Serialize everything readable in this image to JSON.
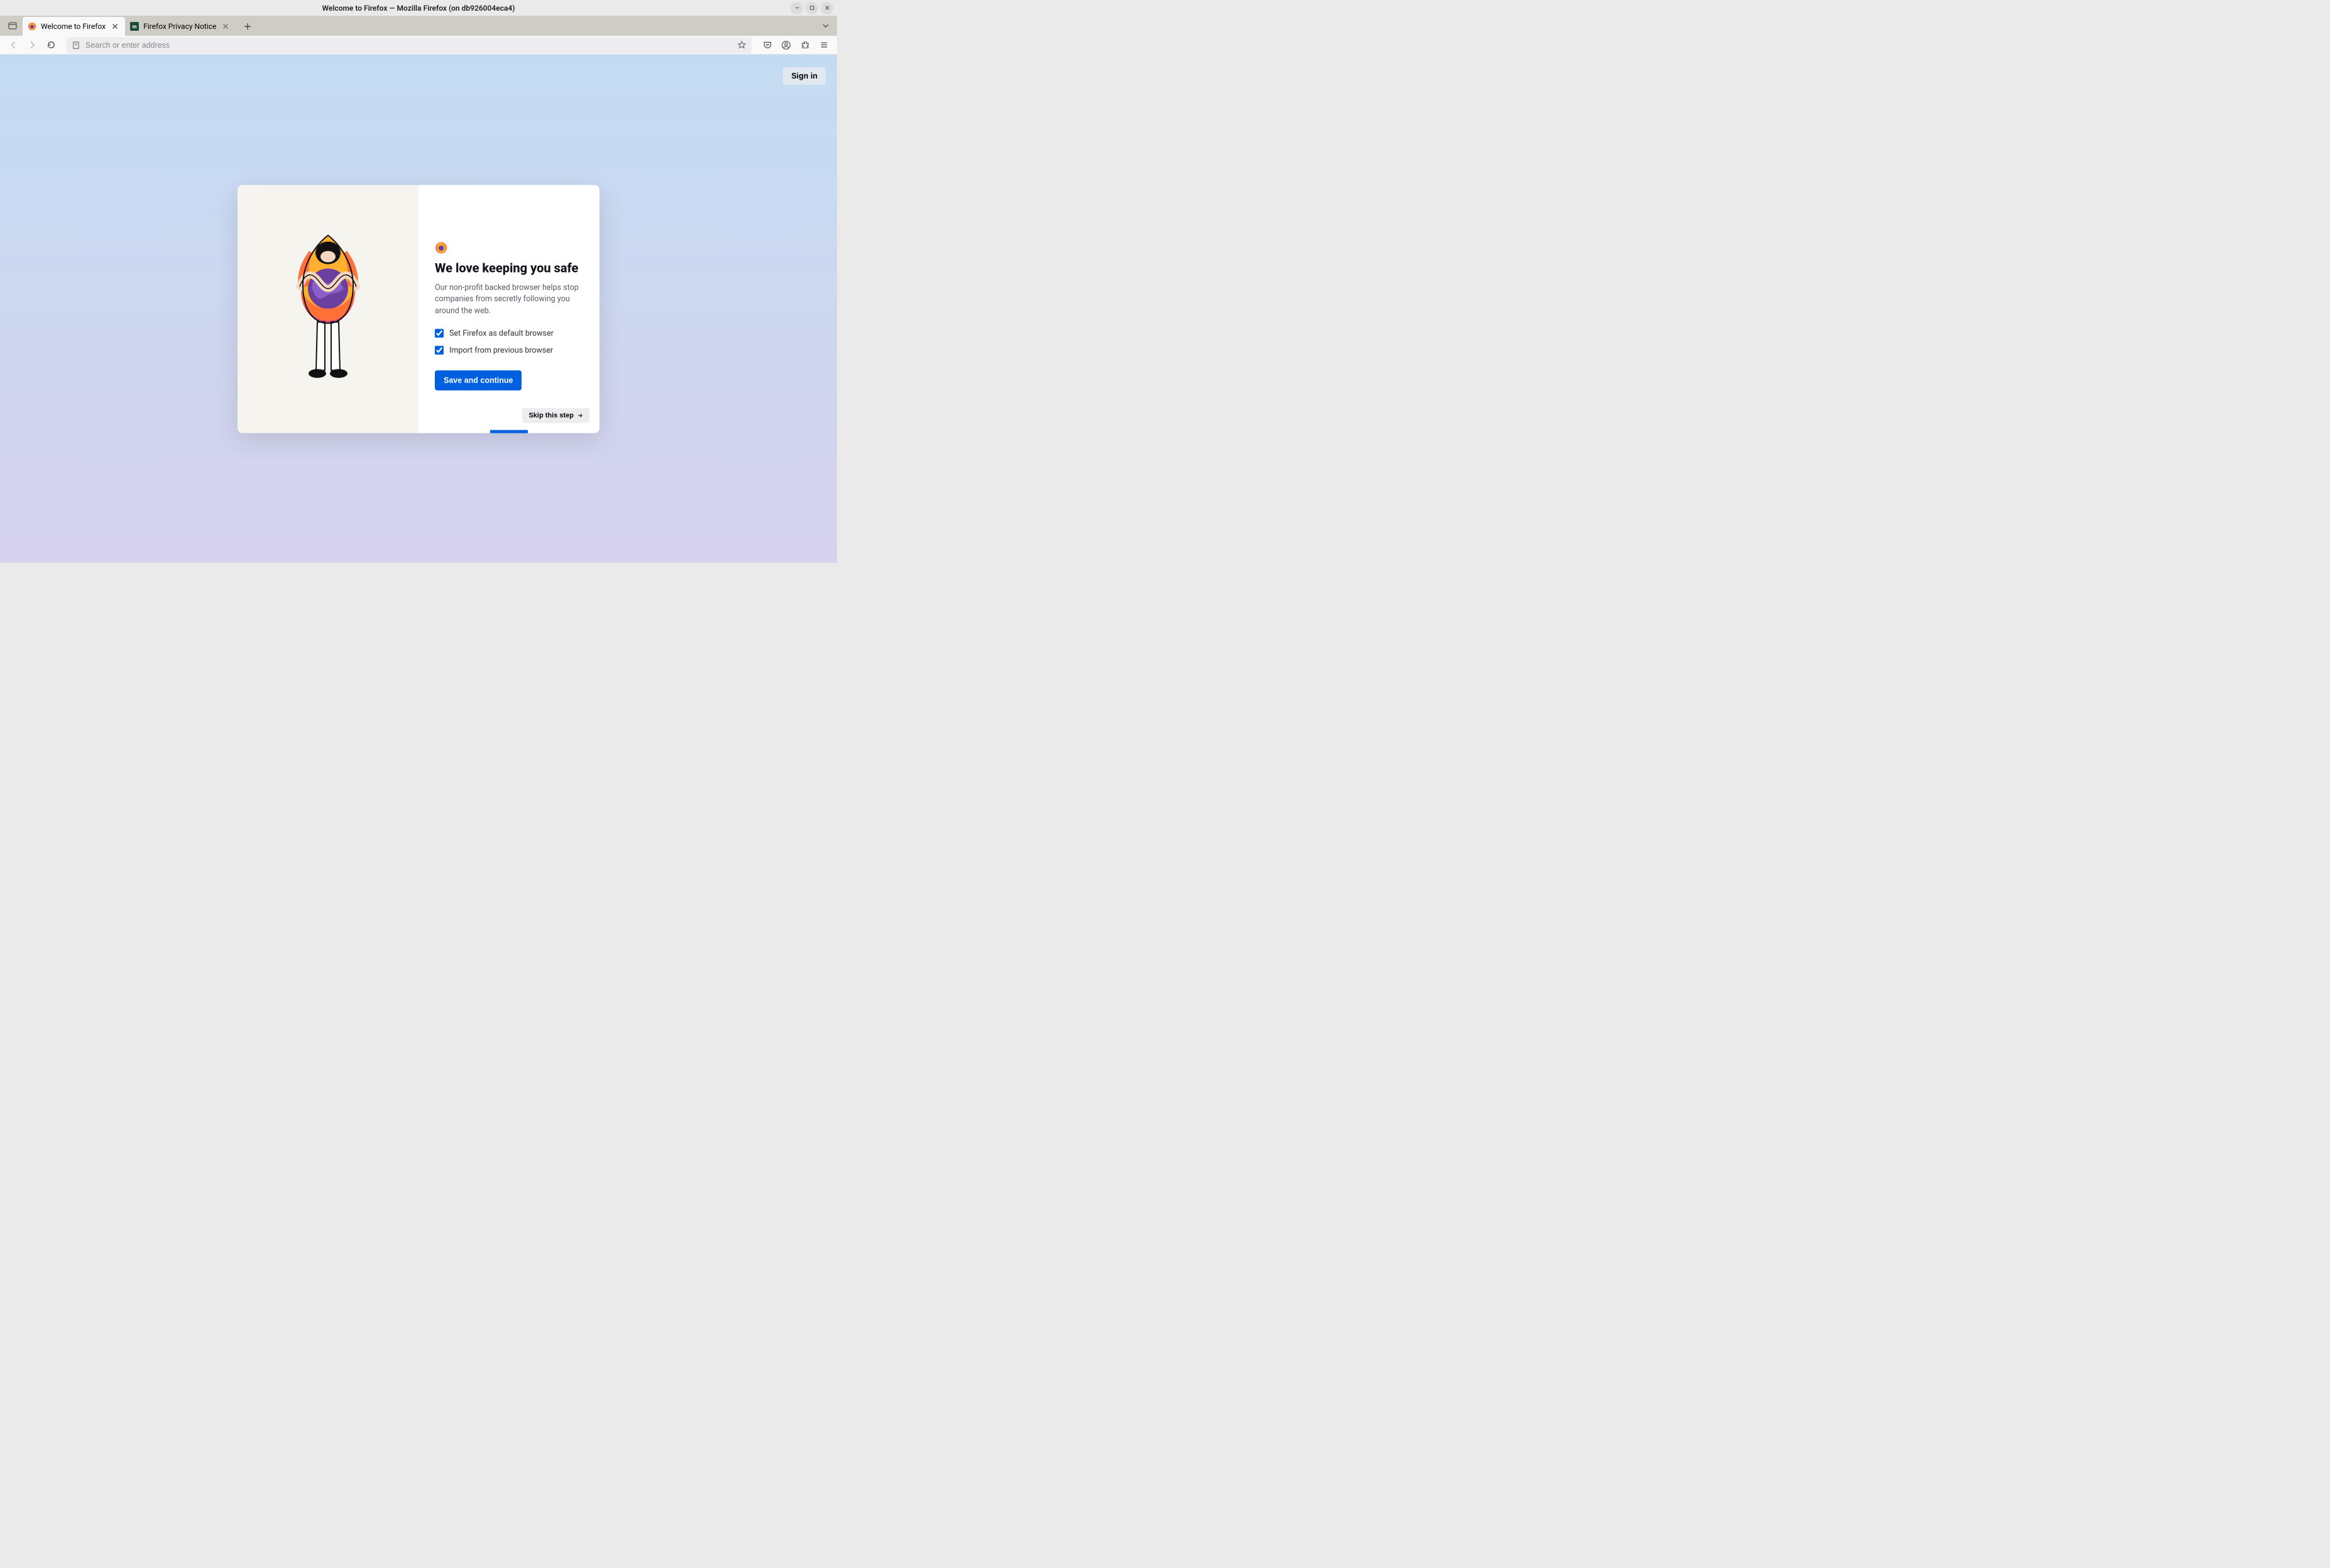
{
  "window": {
    "title": "Welcome to Firefox — Mozilla Firefox (on db926004eca4)"
  },
  "tabs": [
    {
      "label": "Welcome to Firefox",
      "active": true
    },
    {
      "label": "Firefox Privacy Notice",
      "active": false
    }
  ],
  "urlbar": {
    "placeholder": "Search or enter address",
    "value": ""
  },
  "page": {
    "signin": "Sign in"
  },
  "modal": {
    "title": "We love keeping you safe",
    "body": "Our non-profit backed browser helps stop companies from secretly following you around the web.",
    "check1_label": "Set Firefox as default browser",
    "check1_checked": true,
    "check2_label": "Import from previous browser",
    "check2_checked": true,
    "primary": "Save and continue",
    "skip": "Skip this step"
  }
}
